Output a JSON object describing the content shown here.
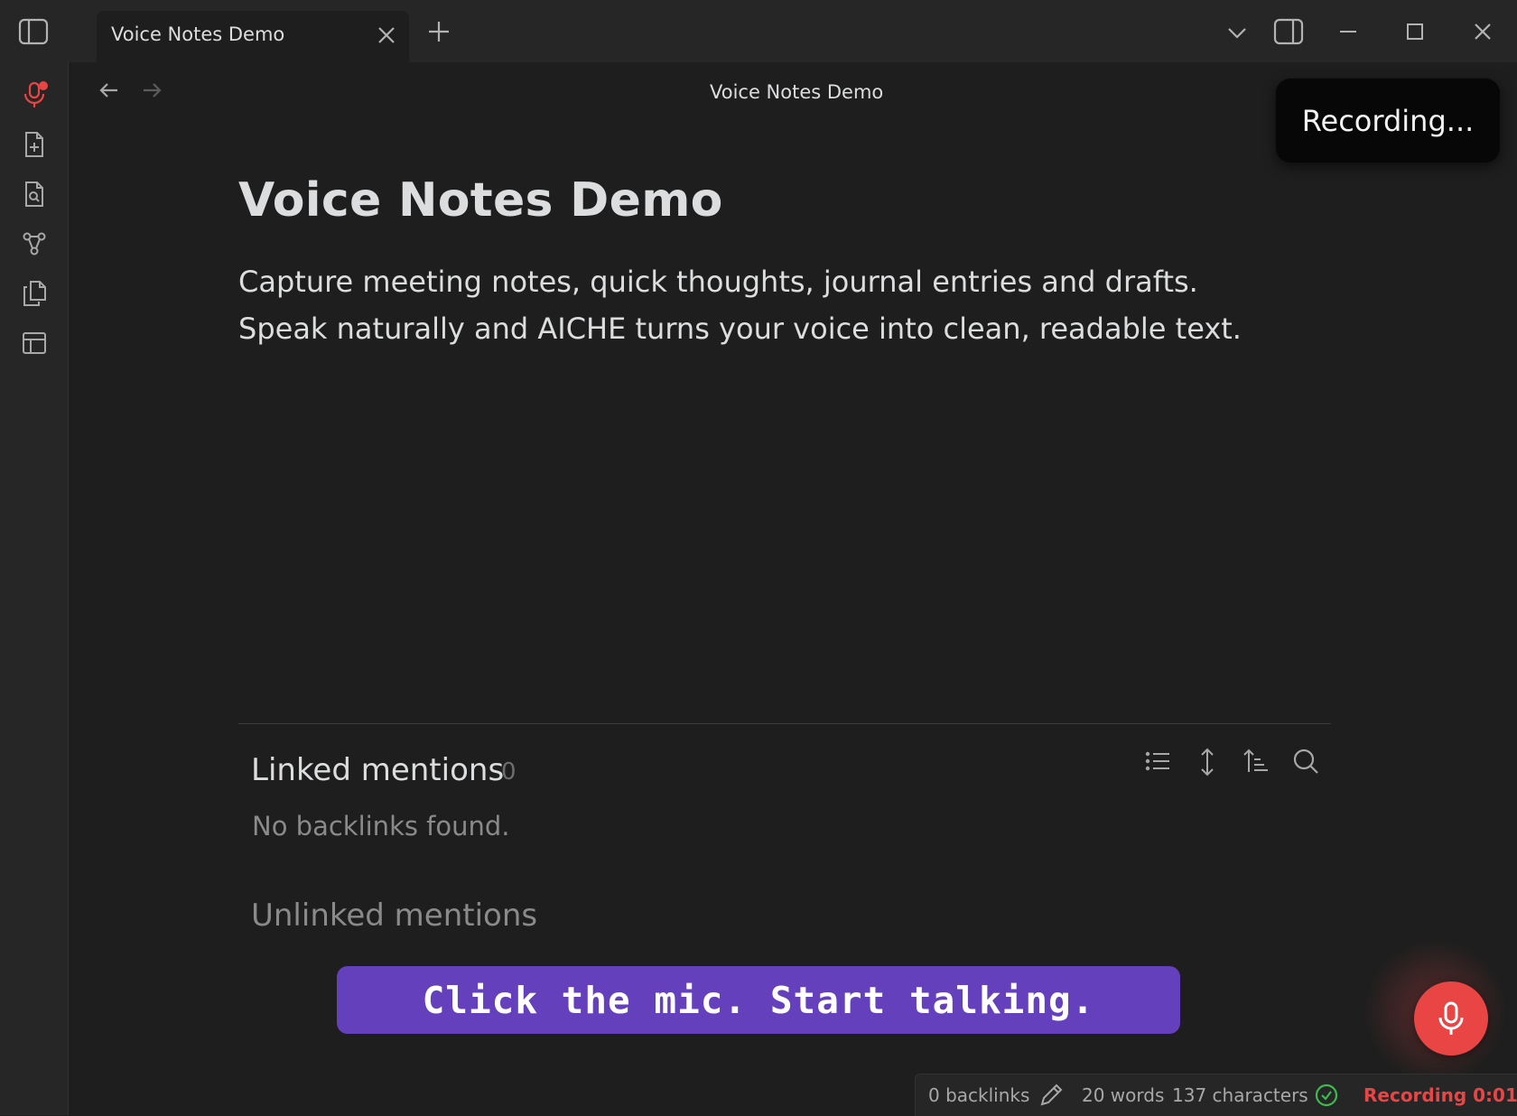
{
  "window": {
    "tab_title": "Voice Notes Demo",
    "view_title": "Voice Notes Demo"
  },
  "ribbon": {
    "icons": [
      "microphone-icon",
      "new-note-icon",
      "search-note-icon",
      "graph-icon",
      "copy-icon",
      "template-icon"
    ],
    "recording_indicator_color": "#e94545"
  },
  "toast": {
    "text": "Recording..."
  },
  "note": {
    "title": "Voice Notes Demo",
    "body": "Capture meeting notes, quick thoughts, journal entries and drafts. Speak naturally and AICHE turns your voice into clean, readable text."
  },
  "backlinks": {
    "linked_title": "Linked mentions",
    "linked_count": "0",
    "empty_text": "No backlinks found.",
    "unlinked_title": "Unlinked mentions"
  },
  "banner": {
    "text": "Click the mic. Start talking.",
    "color": "#6540bd"
  },
  "mic_button": {
    "color": "#e94545"
  },
  "status": {
    "backlinks": "0 backlinks",
    "words": "20 words",
    "characters": "137 characters",
    "recording": "Recording 0:01"
  }
}
